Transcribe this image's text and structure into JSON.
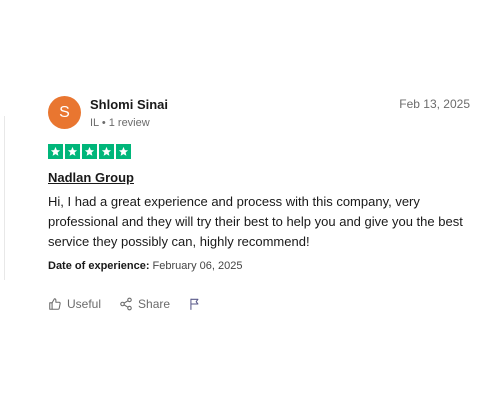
{
  "reviewer": {
    "avatar_letter": "S",
    "avatar_color": "#e97630",
    "name": "Shlomi Sinai",
    "meta": "IL • 1 review"
  },
  "review": {
    "date": "Feb 13, 2025",
    "rating": 5,
    "star_color": "#00b67a",
    "title": "Nadlan Group",
    "body": "Hi, I had a great experience and process with this company, very professional and they will try their best to help you and give you the best service they possibly can, highly recommend!",
    "date_of_experience_label": "Date of experience:",
    "date_of_experience_value": "February 06, 2025"
  },
  "actions": {
    "useful_label": "Useful",
    "share_label": "Share",
    "useful_icon": "thumbs-up-icon",
    "share_icon": "share-icon",
    "report_icon": "flag-icon"
  }
}
